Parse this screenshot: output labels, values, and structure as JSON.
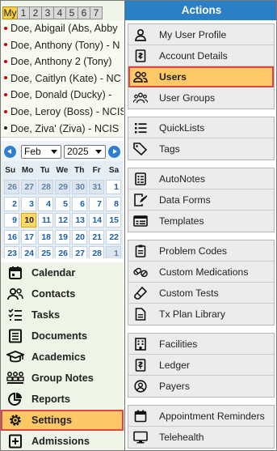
{
  "tabs": [
    "My",
    "1",
    "2",
    "3",
    "4",
    "5",
    "6",
    "7"
  ],
  "patients": [
    {
      "name": "Doe, Abigail (Abs, Abby",
      "dot": "red"
    },
    {
      "name": "Doe, Anthony (Tony) - N",
      "dot": "red"
    },
    {
      "name": "Doe, Anthony 2 (Tony)",
      "dot": "red"
    },
    {
      "name": "Doe, Caitlyn (Kate) - NC",
      "dot": "red"
    },
    {
      "name": "Doe, Donald (Ducky) -",
      "dot": "red"
    },
    {
      "name": "Doe, Leroy (Boss) - NCIS",
      "dot": "red"
    },
    {
      "name": "Doe, Ziva' (Ziva) - NCIS",
      "dot": "black"
    }
  ],
  "calendar": {
    "month": "Feb",
    "year": "2025",
    "weekdays": [
      "Su",
      "Mo",
      "Tu",
      "We",
      "Th",
      "Fr",
      "Sa"
    ],
    "weeks": [
      [
        "26",
        "27",
        "28",
        "29",
        "30",
        "31",
        "1"
      ],
      [
        "2",
        "3",
        "4",
        "5",
        "6",
        "7",
        "8"
      ],
      [
        "9",
        "10",
        "11",
        "12",
        "13",
        "14",
        "15"
      ],
      [
        "16",
        "17",
        "18",
        "19",
        "20",
        "21",
        "22"
      ],
      [
        "23",
        "24",
        "25",
        "26",
        "27",
        "28",
        "1"
      ]
    ],
    "today": "10"
  },
  "left_menu": [
    {
      "label": "Calendar",
      "icon": "calendar-icon"
    },
    {
      "label": "Contacts",
      "icon": "contacts-icon"
    },
    {
      "label": "Tasks",
      "icon": "tasks-icon"
    },
    {
      "label": "Documents",
      "icon": "documents-icon"
    },
    {
      "label": "Academics",
      "icon": "academics-icon"
    },
    {
      "label": "Group Notes",
      "icon": "group-notes-icon"
    },
    {
      "label": "Reports",
      "icon": "reports-icon"
    },
    {
      "label": "Settings",
      "icon": "settings-icon",
      "active": true
    },
    {
      "label": "Admissions",
      "icon": "admissions-icon"
    }
  ],
  "actions": {
    "title": "Actions",
    "groups": [
      [
        {
          "label": "My User Profile",
          "icon": "user-profile-icon"
        },
        {
          "label": "Account Details",
          "icon": "account-details-icon"
        },
        {
          "label": "Users",
          "icon": "users-icon",
          "active": true
        },
        {
          "label": "User Groups",
          "icon": "user-groups-icon"
        }
      ],
      [
        {
          "label": "QuickLists",
          "icon": "quicklists-icon"
        },
        {
          "label": "Tags",
          "icon": "tags-icon"
        }
      ],
      [
        {
          "label": "AutoNotes",
          "icon": "autonotes-icon"
        },
        {
          "label": "Data Forms",
          "icon": "data-forms-icon"
        },
        {
          "label": "Templates",
          "icon": "templates-icon"
        }
      ],
      [
        {
          "label": "Problem Codes",
          "icon": "problem-codes-icon"
        },
        {
          "label": "Custom Medications",
          "icon": "medications-icon"
        },
        {
          "label": "Custom Tests",
          "icon": "tests-icon"
        },
        {
          "label": "Tx Plan Library",
          "icon": "tx-plan-icon"
        }
      ],
      [
        {
          "label": "Facilities",
          "icon": "facilities-icon"
        },
        {
          "label": "Ledger",
          "icon": "ledger-icon"
        },
        {
          "label": "Payers",
          "icon": "payers-icon"
        }
      ],
      [
        {
          "label": "Appointment Reminders",
          "icon": "reminders-icon"
        },
        {
          "label": "Telehealth",
          "icon": "telehealth-icon"
        }
      ]
    ]
  },
  "colors": {
    "header": "#2b7fc4",
    "active": "#fcc866",
    "active_outline": "#e04545"
  }
}
